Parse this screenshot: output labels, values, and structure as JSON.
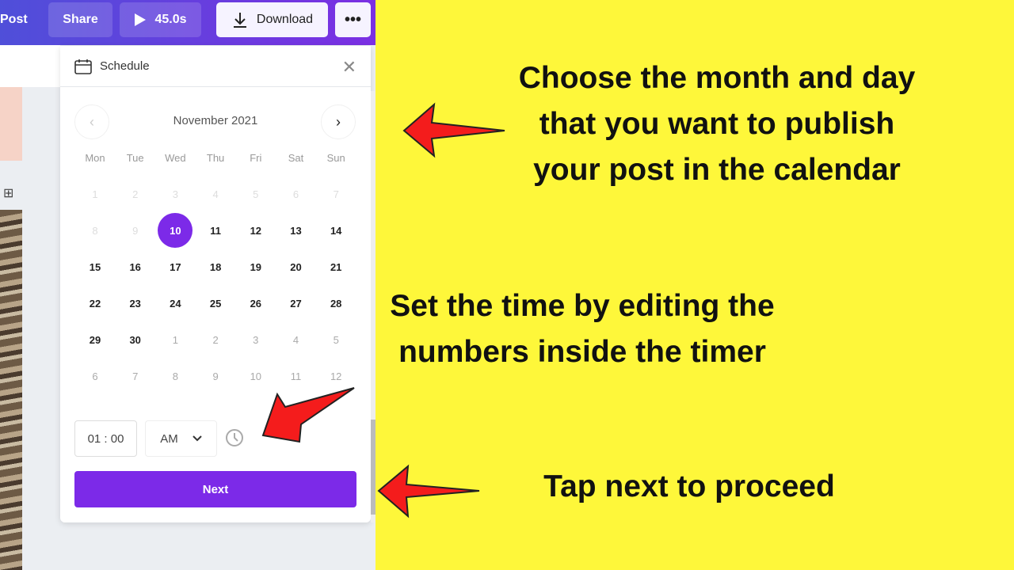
{
  "toolbar": {
    "post_label": "Post",
    "share_label": "Share",
    "play_duration": "45.0s",
    "download_label": "Download",
    "more_label": "•••"
  },
  "schedule": {
    "title": "Schedule",
    "month_label": "November 2021",
    "weekdays": [
      "Mon",
      "Tue",
      "Wed",
      "Thu",
      "Fri",
      "Sat",
      "Sun"
    ],
    "weeks": [
      [
        {
          "d": "1",
          "s": "past"
        },
        {
          "d": "2",
          "s": "past"
        },
        {
          "d": "3",
          "s": "past"
        },
        {
          "d": "4",
          "s": "past"
        },
        {
          "d": "5",
          "s": "past"
        },
        {
          "d": "6",
          "s": "past"
        },
        {
          "d": "7",
          "s": "past"
        }
      ],
      [
        {
          "d": "8",
          "s": "past"
        },
        {
          "d": "9",
          "s": "past"
        },
        {
          "d": "10",
          "s": "sel"
        },
        {
          "d": "11",
          "s": "cur"
        },
        {
          "d": "12",
          "s": "cur"
        },
        {
          "d": "13",
          "s": "cur"
        },
        {
          "d": "14",
          "s": "cur"
        }
      ],
      [
        {
          "d": "15",
          "s": "cur"
        },
        {
          "d": "16",
          "s": "cur"
        },
        {
          "d": "17",
          "s": "cur"
        },
        {
          "d": "18",
          "s": "cur"
        },
        {
          "d": "19",
          "s": "cur"
        },
        {
          "d": "20",
          "s": "cur"
        },
        {
          "d": "21",
          "s": "cur"
        }
      ],
      [
        {
          "d": "22",
          "s": "cur"
        },
        {
          "d": "23",
          "s": "cur"
        },
        {
          "d": "24",
          "s": "cur"
        },
        {
          "d": "25",
          "s": "cur"
        },
        {
          "d": "26",
          "s": "cur"
        },
        {
          "d": "27",
          "s": "cur"
        },
        {
          "d": "28",
          "s": "cur"
        }
      ],
      [
        {
          "d": "29",
          "s": "cur"
        },
        {
          "d": "30",
          "s": "cur"
        },
        {
          "d": "1",
          "s": "other"
        },
        {
          "d": "2",
          "s": "other"
        },
        {
          "d": "3",
          "s": "other"
        },
        {
          "d": "4",
          "s": "other"
        },
        {
          "d": "5",
          "s": "other"
        }
      ],
      [
        {
          "d": "6",
          "s": "other"
        },
        {
          "d": "7",
          "s": "other"
        },
        {
          "d": "8",
          "s": "other"
        },
        {
          "d": "9",
          "s": "other"
        },
        {
          "d": "10",
          "s": "other"
        },
        {
          "d": "11",
          "s": "other"
        },
        {
          "d": "12",
          "s": "other"
        }
      ]
    ],
    "selected_day": "10",
    "time_value": "01 : 00",
    "ampm_value": "AM",
    "next_label": "Next"
  },
  "annotations": {
    "calendar": "Choose the month and day that you want to publish your post in the calendar",
    "timer": "Set the time by editing the numbers inside the timer",
    "next": "Tap next to proceed"
  },
  "colors": {
    "accent": "#7c2ae8",
    "background_yellow": "#fef73a",
    "arrow": "#f41c1c"
  }
}
